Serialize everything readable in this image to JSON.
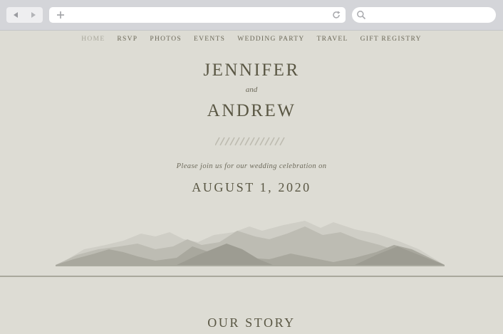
{
  "browser": {
    "back_icon": "back-arrow-icon",
    "forward_icon": "forward-arrow-icon",
    "new_tab_icon": "plus-icon",
    "reload_icon": "reload-icon",
    "search_icon": "search-icon"
  },
  "nav": {
    "items": [
      "HOME",
      "RSVP",
      "PHOTOS",
      "EVENTS",
      "WEDDING PARTY",
      "TRAVEL",
      "GIFT REGISTRY"
    ],
    "active": "HOME"
  },
  "hero": {
    "name1": "JENNIFER",
    "conjunction": "and",
    "name2": "ANDREW",
    "invite": "Please join us for our wedding celebration on",
    "date": "AUGUST 1, 2020"
  },
  "story": {
    "heading": "OUR STORY"
  },
  "colors": {
    "background": "#dddcd4",
    "text": "#5a5744",
    "muted": "#a9a89c"
  }
}
